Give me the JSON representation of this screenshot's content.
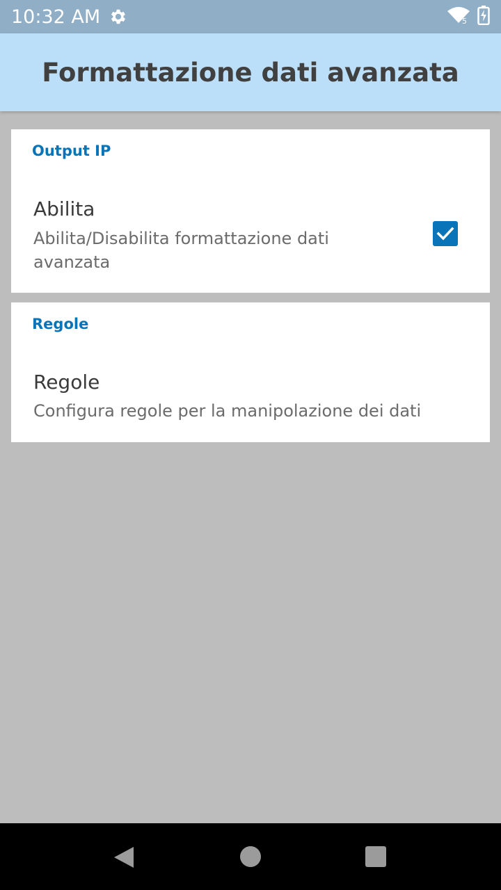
{
  "status_bar": {
    "time": "10:32 AM",
    "icons": [
      "gear-icon",
      "wifi-icon",
      "battery-charging-icon"
    ],
    "wifi_label": "5"
  },
  "app_bar": {
    "title": "Formattazione dati avanzata"
  },
  "sections": [
    {
      "category": "Output IP",
      "title": "Abilita",
      "summary": "Abilita/Disabilita formattazione dati avanzata",
      "checkbox": {
        "checked": true
      }
    },
    {
      "category": "Regole",
      "title": "Regole",
      "summary": "Configura regole per la manipolazione dei dati"
    }
  ],
  "navigation": {
    "buttons": [
      "back-icon",
      "home-icon",
      "recents-icon"
    ]
  },
  "colors": {
    "status_bar": "#90aec6",
    "app_bar": "#bbdef9",
    "accent": "#0a74b8",
    "background": "#bdbdbd"
  }
}
